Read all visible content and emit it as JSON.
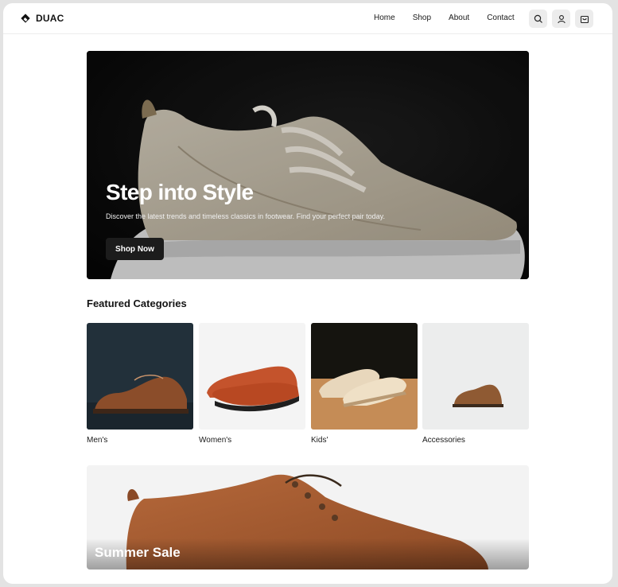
{
  "brand": {
    "name": "DUAC"
  },
  "nav": {
    "items": [
      "Home",
      "Shop",
      "About",
      "Contact"
    ]
  },
  "header_icons": [
    "search-icon",
    "user-icon",
    "cart-icon"
  ],
  "hero": {
    "title": "Step into Style",
    "subtitle": "Discover the latest trends and timeless classics in footwear. Find your perfect pair today.",
    "cta_label": "Shop Now"
  },
  "featured": {
    "title": "Featured Categories",
    "categories": [
      "Men's",
      "Women's",
      "Kids'",
      "Accessories"
    ]
  },
  "promo": {
    "title": "Summer Sale"
  },
  "colors": {
    "accent": "#1c1c1c",
    "background": "#ffffff",
    "frame": "#e3e3e3"
  }
}
